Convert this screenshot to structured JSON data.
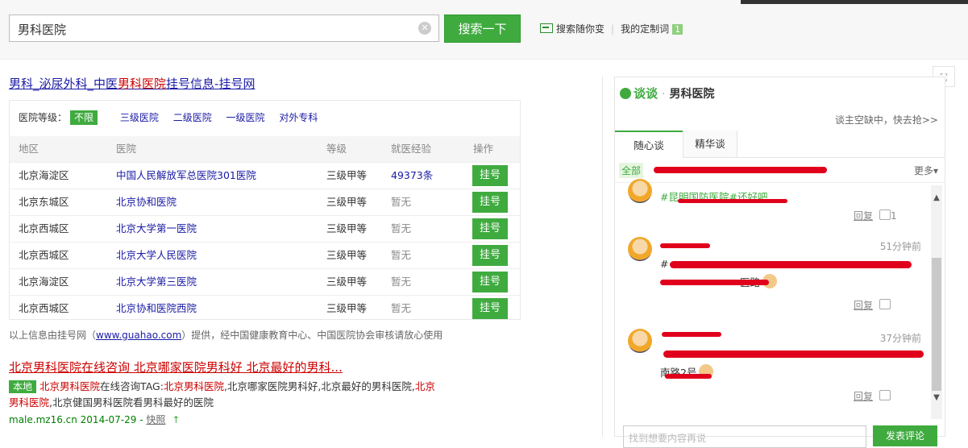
{
  "search": {
    "query": "男科医院",
    "button": "搜索一下"
  },
  "top_links": {
    "kw_label": "搜索随你变",
    "custom_label": "我的定制词",
    "custom_badge": "1"
  },
  "result1": {
    "title_pre": "男科_泌尿外科_中医",
    "title_hl": "男科医院",
    "title_post": "挂号信息-挂号网",
    "levels_label": "医院等级：",
    "levels": [
      "不限",
      "三级医院",
      "二级医院",
      "一级医院",
      "对外专科"
    ],
    "columns": [
      "地区",
      "医院",
      "等级",
      "就医经验",
      "操作"
    ],
    "rows": [
      {
        "area": "北京海淀区",
        "hospital": "中国人民解放军总医院301医院",
        "grade": "三级甲等",
        "exp": "49373条",
        "op": "挂号"
      },
      {
        "area": "北京东城区",
        "hospital": "北京协和医院",
        "grade": "三级甲等",
        "exp": "暂无",
        "op": "挂号"
      },
      {
        "area": "北京西城区",
        "hospital": "北京大学第一医院",
        "grade": "三级甲等",
        "exp": "暂无",
        "op": "挂号"
      },
      {
        "area": "北京西城区",
        "hospital": "北京大学人民医院",
        "grade": "三级甲等",
        "exp": "暂无",
        "op": "挂号"
      },
      {
        "area": "北京海淀区",
        "hospital": "北京大学第三医院",
        "grade": "三级甲等",
        "exp": "暂无",
        "op": "挂号"
      },
      {
        "area": "北京西城区",
        "hospital": "北京协和医院西院",
        "grade": "三级甲等",
        "exp": "暂无",
        "op": "挂号"
      }
    ],
    "note_pre": "以上信息由挂号网（",
    "note_link": "www.guahao.com",
    "note_post": "）提供，经中国健康教育中心、中国医院协会审核请放心使用"
  },
  "result2": {
    "title": "北京男科医院在线咨询 北京哪家医院男科好 北京最好的男科...",
    "local": "本地",
    "s1": "北京男科医院",
    "s2": "在线咨询TAG:",
    "s3": "北京男科医院",
    "s4": ",北京哪家医院男科好,北京最好的男科医院,",
    "s5": "北京男科医院",
    "s6": ",北京健国男科医院看男科最好的医院",
    "url": "male.mz16.cn 2014-07-29 - ",
    "snapshot": "快照",
    "up": "↑"
  },
  "panel": {
    "brand": "谈谈",
    "dot": "·",
    "name": "男科医院",
    "host": "谈主空缺中，快去抢>>",
    "tab_active": "随心谈",
    "tab_other": "精华谈",
    "filter_all": "全部",
    "more": "更多▾",
    "posts": [
      {
        "text": "#昆明国防医院#还好吧",
        "reply": "回复",
        "likes": "1"
      },
      {
        "time": "51分钟前",
        "text1": "#",
        "text2": "医路",
        "reply": "回复"
      },
      {
        "time": "37分钟前",
        "text1": "南路2号",
        "reply": "回复"
      }
    ],
    "input_placeholder": "找到想要内容再说",
    "post_button": "发表评论"
  },
  "colors": {
    "accent": "#3fab3f",
    "link": "#1a1aa6",
    "highlight": "#cc0000",
    "redaction": "#e0001b"
  }
}
